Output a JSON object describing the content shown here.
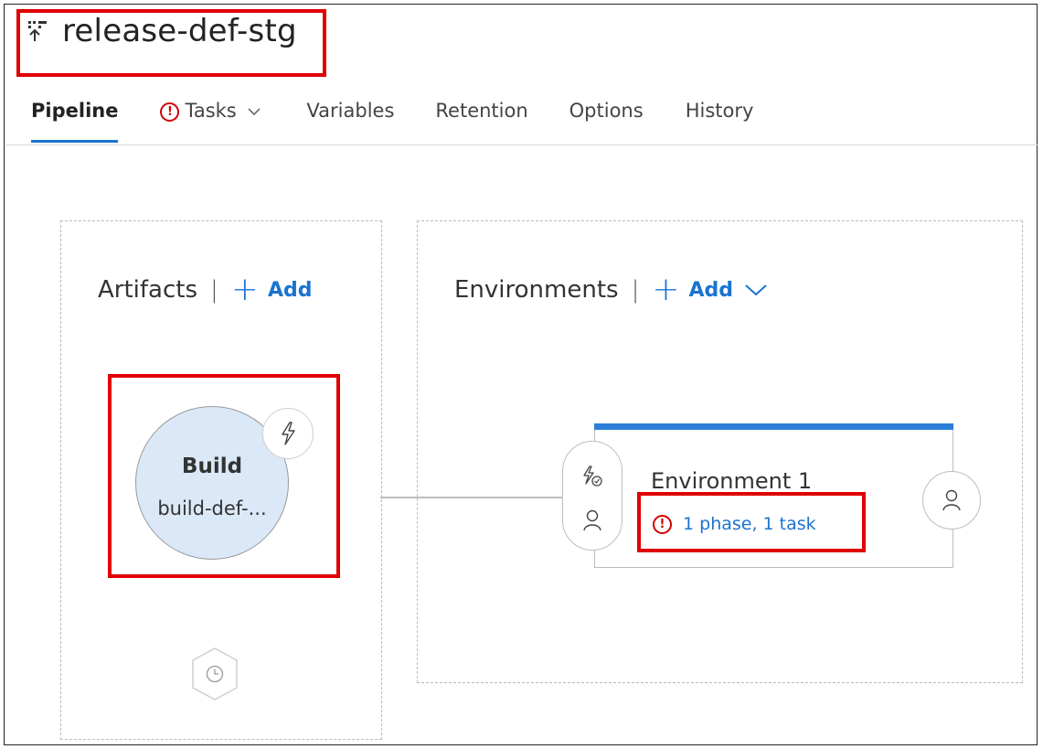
{
  "definition": {
    "title": "release-def-stg"
  },
  "tabs": [
    {
      "label": "Pipeline",
      "active": true
    },
    {
      "label": "Tasks",
      "has_error": true,
      "has_dropdown": true
    },
    {
      "label": "Variables"
    },
    {
      "label": "Retention"
    },
    {
      "label": "Options"
    },
    {
      "label": "History"
    }
  ],
  "artifacts": {
    "heading": "Artifacts",
    "separator": "|",
    "add_label": "Add",
    "items": [
      {
        "title": "Build",
        "subtitle": "build-def-..."
      }
    ]
  },
  "environments": {
    "heading": "Environments",
    "separator": "|",
    "add_label": "Add",
    "items": [
      {
        "name": "Environment 1",
        "status": "1 phase, 1 task",
        "status_has_error": true
      }
    ]
  },
  "icons": {
    "title": "release-definition-icon",
    "tasks_error": "exclamation-circle-icon",
    "add": "plus-icon",
    "dropdown": "chevron-down-icon",
    "artifact_trigger": "lightning-bolt-icon",
    "schedule": "clock-hexagon-icon",
    "pre_deployment_trigger": "lightning-check-icon",
    "pre_deployment_approvers": "person-icon",
    "post_deployment_approvers": "person-icon"
  },
  "colors": {
    "accent": "#1a73d0",
    "error": "#d00000",
    "highlight_box": "#e00000",
    "environment_bar": "#2b7fd8",
    "artifact_fill": "#dbe8f7"
  }
}
